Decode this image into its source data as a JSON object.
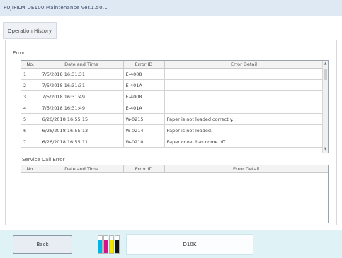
{
  "window": {
    "title": "FUJIFILM DE100 Maintenance Ver.1.50.1"
  },
  "tabs": [
    {
      "label": "Operation History"
    }
  ],
  "error_section": {
    "label": "Error",
    "columns": [
      "No.",
      "Date and Time",
      "Error ID",
      "Error Detail"
    ],
    "rows": [
      {
        "no": "1",
        "datetime": "7/5/2018 16:31:31",
        "error_id": "E-4008",
        "detail": ""
      },
      {
        "no": "2",
        "datetime": "7/5/2018 16:31:31",
        "error_id": "E-401A",
        "detail": ""
      },
      {
        "no": "3",
        "datetime": "7/5/2018 16:31:49",
        "error_id": "E-4008",
        "detail": ""
      },
      {
        "no": "4",
        "datetime": "7/5/2018 16:31:49",
        "error_id": "E-401A",
        "detail": ""
      },
      {
        "no": "5",
        "datetime": "6/26/2018 16:55:15",
        "error_id": "W-0215",
        "detail": "Paper is not loaded correctly."
      },
      {
        "no": "6",
        "datetime": "6/26/2018 16:55:13",
        "error_id": "W-0214",
        "detail": "Paper is not loaded."
      },
      {
        "no": "7",
        "datetime": "6/26/2018 16:55:11",
        "error_id": "W-0210",
        "detail": "Paper cover has come off."
      }
    ]
  },
  "service_section": {
    "label": "Service Call Error",
    "columns": [
      "No.",
      "Date and Time",
      "Error ID",
      "Error Detail"
    ],
    "rows": []
  },
  "footer": {
    "back_label": "Back",
    "status_text": "D10K",
    "ink_colors": [
      "#00b4e8",
      "#d4148c",
      "#f2e600",
      "#111111"
    ],
    "ink_levels": [
      0.8,
      0.8,
      0.8,
      0.8
    ]
  }
}
